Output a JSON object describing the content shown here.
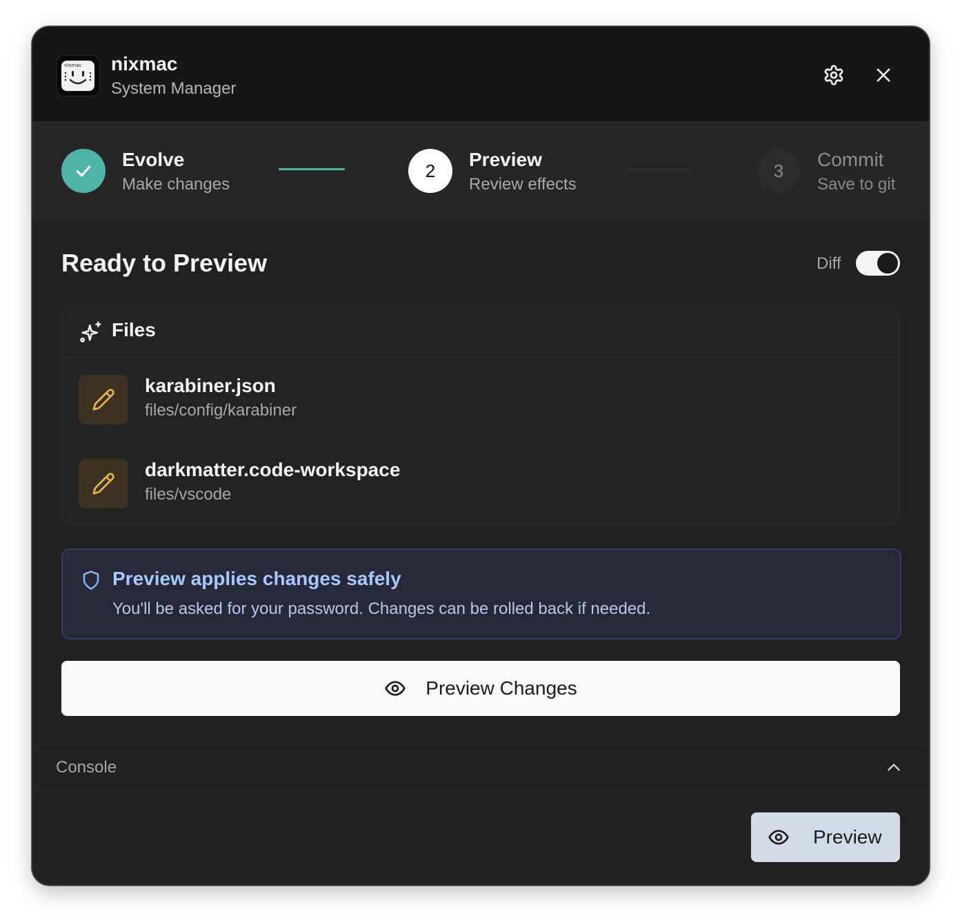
{
  "app": {
    "name": "nixmac",
    "subtitle": "System Manager",
    "logo_text": "nixmac"
  },
  "header_icons": {
    "settings": "gear-icon",
    "close": "close-icon"
  },
  "steps": [
    {
      "number": "1",
      "title": "Evolve",
      "subtitle": "Make changes",
      "state": "completed"
    },
    {
      "number": "2",
      "title": "Preview",
      "subtitle": "Review effects",
      "state": "active"
    },
    {
      "number": "3",
      "title": "Commit",
      "subtitle": "Save to git",
      "state": "pending"
    }
  ],
  "main": {
    "title": "Ready to Preview",
    "diff_label": "Diff",
    "diff_enabled": true
  },
  "files": {
    "title": "Files",
    "items": [
      {
        "name": "karabiner.json",
        "path": "files/config/karabiner",
        "icon": "pencil-icon"
      },
      {
        "name": "darkmatter.code-workspace",
        "path": "files/vscode",
        "icon": "pencil-icon"
      }
    ]
  },
  "info": {
    "title": "Preview applies changes safely",
    "text": "You'll be asked for your password. Changes can be rolled back if needed."
  },
  "actions": {
    "preview_changes_label": "Preview Changes",
    "preview_label": "Preview"
  },
  "console": {
    "label": "Console",
    "expanded": false
  },
  "colors": {
    "accent_teal": "#4fb3a5",
    "info_blue": "#a8c8ff",
    "file_icon_amber": "#e9b24a"
  }
}
